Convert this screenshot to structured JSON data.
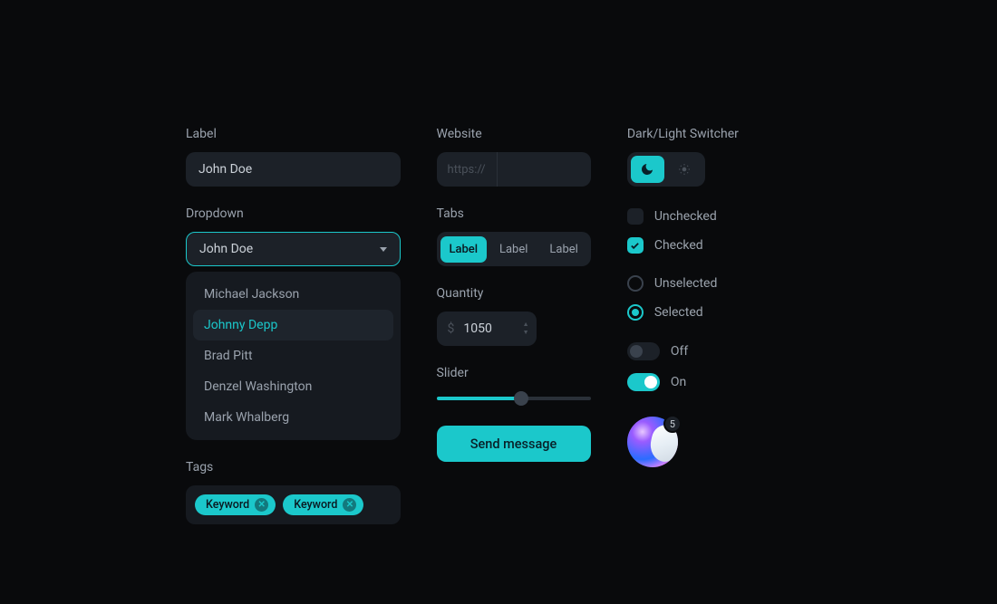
{
  "col1": {
    "label": "Label",
    "input_value": "John Doe",
    "dropdown_label": "Dropdown",
    "dropdown_value": "John Doe",
    "menu_items": [
      "Michael Jackson",
      "Johnny Depp",
      "Brad Pitt",
      "Denzel Washington",
      "Mark Whalberg"
    ],
    "menu_selected_index": 1,
    "tags_label": "Tags",
    "tags": [
      "Keyword",
      "Keyword"
    ]
  },
  "col2": {
    "website_label": "Website",
    "website_prefix": "https://",
    "tabs_label": "Tabs",
    "tabs": [
      "Label",
      "Label",
      "Label"
    ],
    "tabs_active_index": 0,
    "quantity_label": "Quantity",
    "quantity_currency": "$",
    "quantity_value": "1050",
    "slider_label": "Slider",
    "slider_percent": 55,
    "button_label": "Send message"
  },
  "col3": {
    "switcher_label": "Dark/Light Switcher",
    "checkbox_unchecked_label": "Unchecked",
    "checkbox_checked_label": "Checked",
    "radio_unselected_label": "Unselected",
    "radio_selected_label": "Selected",
    "toggle_off_label": "Off",
    "toggle_on_label": "On",
    "avatar_badge": "5"
  }
}
